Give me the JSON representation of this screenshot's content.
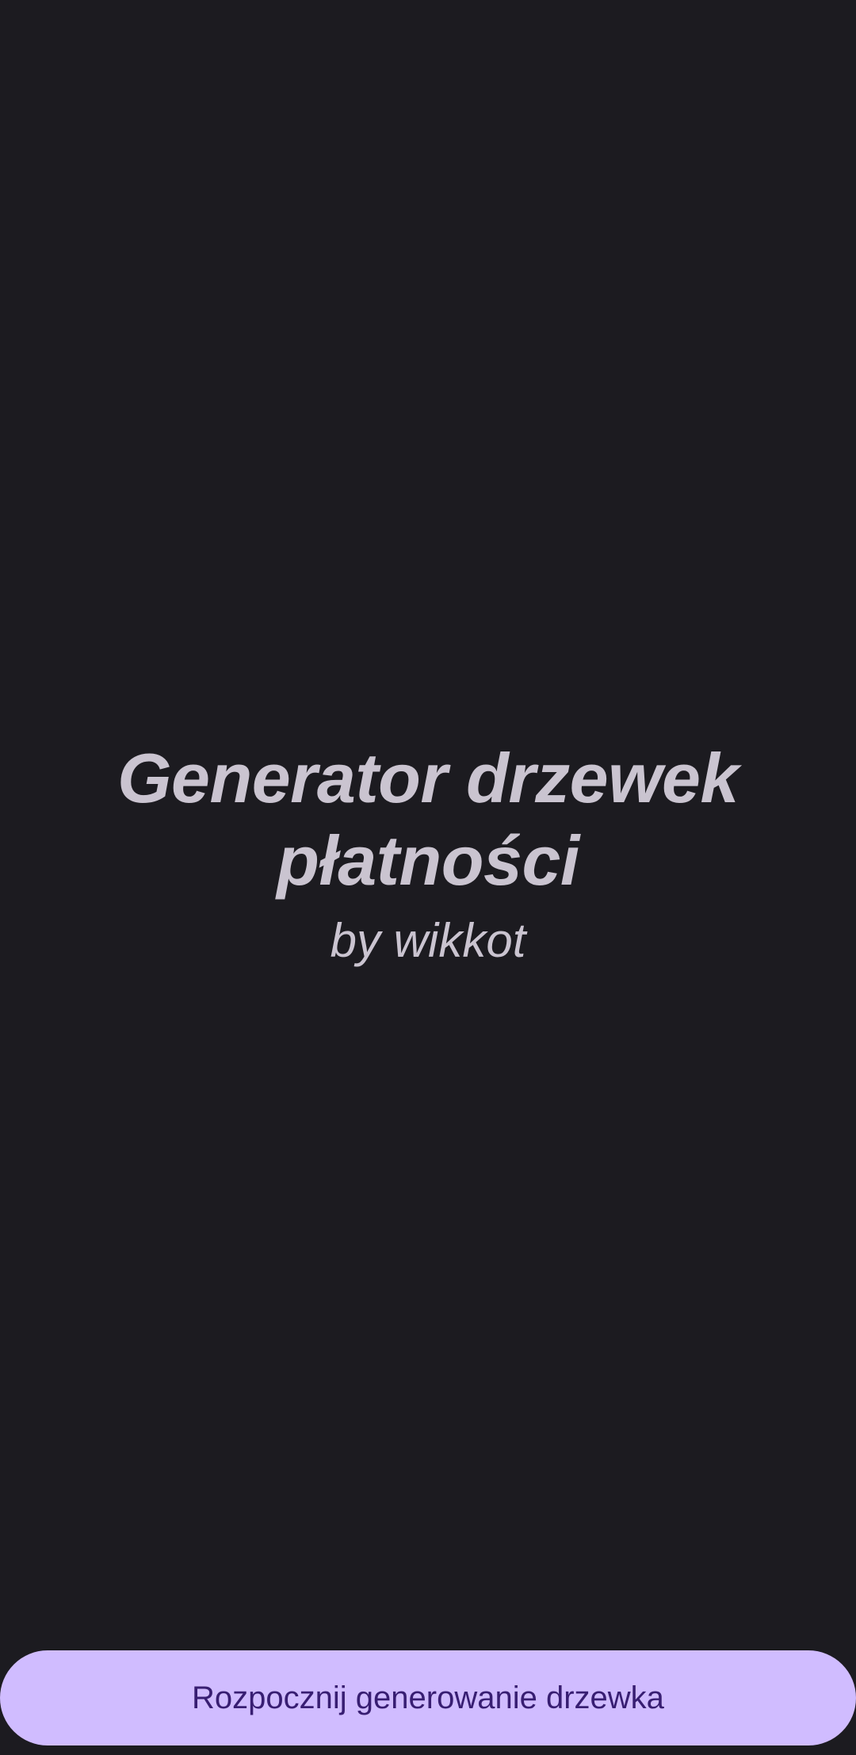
{
  "splash": {
    "title": "Generator drzewek płatności",
    "subtitle": "by wikkot"
  },
  "actions": {
    "start_label": "Rozpocznij generowanie drzewka"
  },
  "colors": {
    "background": "#1c1b20",
    "text": "#cac4d0",
    "button_bg": "#d0bcff",
    "button_text": "#381e72"
  }
}
